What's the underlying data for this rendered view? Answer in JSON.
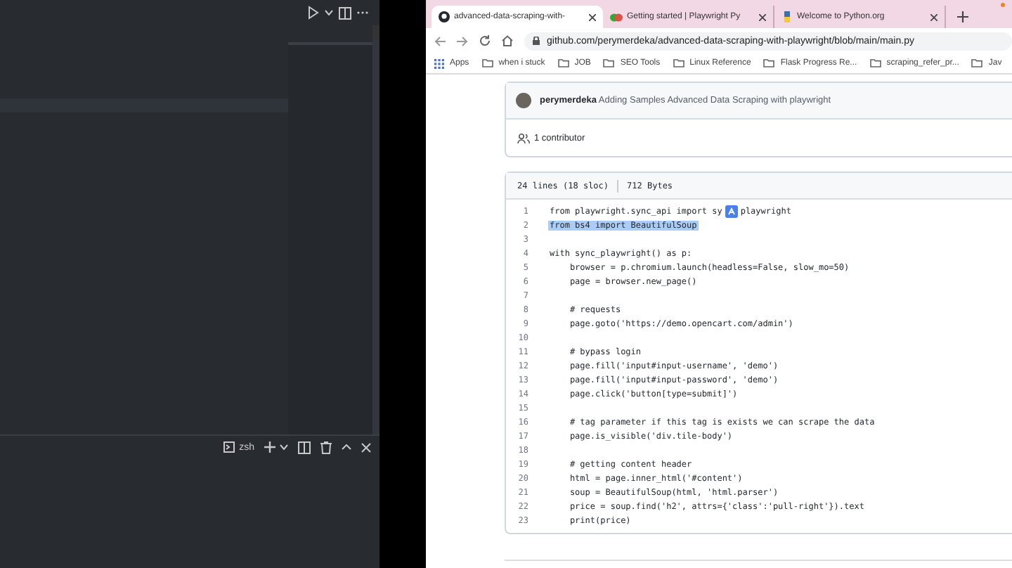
{
  "editor": {
    "terminal": {
      "shell": "zsh"
    }
  },
  "browser": {
    "tabs": [
      {
        "title": "advanced-data-scraping-with-",
        "selected": true,
        "kind": "github"
      },
      {
        "title": "Getting started | Playwright Py",
        "selected": false,
        "kind": "playwright"
      },
      {
        "title": "Welcome to Python.org",
        "selected": false,
        "kind": "python"
      }
    ],
    "address": "github.com/perymerdeka/advanced-data-scraping-with-playwright/blob/main/main.py",
    "bookmarks": [
      {
        "label": "Apps",
        "kind": "apps"
      },
      {
        "label": "when i stuck",
        "kind": "folder"
      },
      {
        "label": "JOB",
        "kind": "folder"
      },
      {
        "label": "SEO Tools",
        "kind": "folder"
      },
      {
        "label": "Linux Reference",
        "kind": "folder"
      },
      {
        "label": "Flask Progress Re...",
        "kind": "folder"
      },
      {
        "label": "scraping_refer_pr...",
        "kind": "folder"
      },
      {
        "label": "Jav",
        "kind": "folder"
      }
    ]
  },
  "commit": {
    "author": "perymerdeka",
    "message": "Adding Samples Advanced Data Scraping with playwright",
    "contributors": "1 contributor"
  },
  "file": {
    "lines_info": "24 lines (18 sloc)",
    "size": "712 Bytes",
    "lines": [
      {
        "number": "1",
        "code": "from playwright.sync_api import sy",
        "code_rest": "playwright",
        "selected": false
      },
      {
        "number": "2",
        "code": "from bs4 import BeautifulSoup",
        "selected": true
      },
      {
        "number": "3"
      },
      {
        "number": "4",
        "code": "with sync_playwright() as p:",
        "selected": false
      },
      {
        "number": "5",
        "code": "    browser = p.chromium.launch(headless=False, slow_mo=50)",
        "selected": false
      },
      {
        "number": "6",
        "code": "    page = browser.new_page()",
        "selected": false
      },
      {
        "number": "7"
      },
      {
        "number": "8",
        "code": "    # requests",
        "selected": false
      },
      {
        "number": "9",
        "code": "    page.goto('https://demo.opencart.com/admin')",
        "selected": false
      },
      {
        "number": "10"
      },
      {
        "number": "11",
        "code": "    # bypass login",
        "selected": false
      },
      {
        "number": "12",
        "code": "    page.fill('input#input-username', 'demo')",
        "selected": false
      },
      {
        "number": "13",
        "code": "    page.fill('input#input-password', 'demo')",
        "selected": false
      },
      {
        "number": "14",
        "code": "    page.click('button[type=submit]')",
        "selected": false
      },
      {
        "number": "15"
      },
      {
        "number": "16",
        "code": "    # tag parameter if this tag is exists we can scrape the data",
        "selected": false
      },
      {
        "number": "17",
        "code": "    page.is_visible('div.tile-body')",
        "selected": false
      },
      {
        "number": "18"
      },
      {
        "number": "19",
        "code": "    # getting content header",
        "selected": false
      },
      {
        "number": "20",
        "code": "    html = page.inner_html('#content')",
        "selected": false
      },
      {
        "number": "21",
        "code": "    soup = BeautifulSoup(html, 'html.parser')",
        "selected": false
      },
      {
        "number": "22",
        "code": "    price = soup.find('h2', attrs={'class':'pull-right'}).text",
        "selected": false
      },
      {
        "number": "23",
        "code": "    print(price)",
        "selected": false
      }
    ]
  }
}
